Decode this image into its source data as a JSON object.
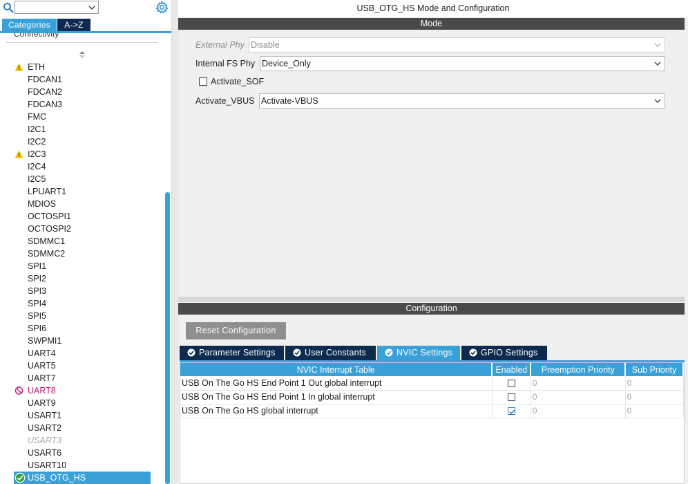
{
  "sidebar": {
    "search": {
      "value": ""
    },
    "tabs": [
      {
        "label": "Categories"
      },
      {
        "label": "A->Z"
      }
    ],
    "group_label": "Connectivity",
    "items": [
      {
        "label": "ETH",
        "status": "warning"
      },
      {
        "label": "FDCAN1",
        "status": "none"
      },
      {
        "label": "FDCAN2",
        "status": "none"
      },
      {
        "label": "FDCAN3",
        "status": "none"
      },
      {
        "label": "FMC",
        "status": "none"
      },
      {
        "label": "I2C1",
        "status": "none"
      },
      {
        "label": "I2C2",
        "status": "none"
      },
      {
        "label": "I2C3",
        "status": "warning"
      },
      {
        "label": "I2C4",
        "status": "none"
      },
      {
        "label": "I2C5",
        "status": "none"
      },
      {
        "label": "LPUART1",
        "status": "none"
      },
      {
        "label": "MDIOS",
        "status": "none"
      },
      {
        "label": "OCTOSPI1",
        "status": "none"
      },
      {
        "label": "OCTOSPI2",
        "status": "none"
      },
      {
        "label": "SDMMC1",
        "status": "none"
      },
      {
        "label": "SDMMC2",
        "status": "none"
      },
      {
        "label": "SPI1",
        "status": "none"
      },
      {
        "label": "SPI2",
        "status": "none"
      },
      {
        "label": "SPI3",
        "status": "none"
      },
      {
        "label": "SPI4",
        "status": "none"
      },
      {
        "label": "SPI5",
        "status": "none"
      },
      {
        "label": "SPI6",
        "status": "none"
      },
      {
        "label": "SWPMI1",
        "status": "none"
      },
      {
        "label": "UART4",
        "status": "none"
      },
      {
        "label": "UART5",
        "status": "none"
      },
      {
        "label": "UART7",
        "status": "none"
      },
      {
        "label": "UART8",
        "status": "error"
      },
      {
        "label": "UART9",
        "status": "none"
      },
      {
        "label": "USART1",
        "status": "none"
      },
      {
        "label": "USART2",
        "status": "none"
      },
      {
        "label": "USART3",
        "status": "disabled"
      },
      {
        "label": "USART6",
        "status": "none"
      },
      {
        "label": "USART10",
        "status": "none"
      },
      {
        "label": "USB_OTG_HS",
        "status": "selected"
      }
    ]
  },
  "main": {
    "title": "USB_OTG_HS Mode and Configuration",
    "mode": {
      "section_label": "Mode",
      "external_phy": {
        "label": "External Phy",
        "value": "Disable"
      },
      "internal_fs_phy": {
        "label": "Internal FS Phy",
        "value": "Device_Only"
      },
      "activate_sof": {
        "label": "Activate_SOF",
        "checked": false
      },
      "activate_vbus": {
        "label": "Activate_VBUS",
        "value": "Activate-VBUS"
      }
    },
    "configuration": {
      "section_label": "Configuration",
      "reset_button": "Reset Configuration",
      "tabs": [
        {
          "label": "Parameter Settings"
        },
        {
          "label": "User Constants"
        },
        {
          "label": "NVIC Settings"
        },
        {
          "label": "GPIO Settings"
        }
      ],
      "nvic": {
        "columns": [
          "NVIC Interrupt Table",
          "Enabled",
          "Preemption Priority",
          "Sub Priority"
        ],
        "rows": [
          {
            "name": "USB On The Go HS End Point 1 Out global interrupt",
            "enabled": false,
            "preemption": "0",
            "sub": "0"
          },
          {
            "name": "USB On The Go HS End Point 1 In global interrupt",
            "enabled": false,
            "preemption": "0",
            "sub": "0"
          },
          {
            "name": "USB On The Go HS global interrupt",
            "enabled": true,
            "preemption": "0",
            "sub": "0"
          }
        ]
      }
    }
  },
  "colors": {
    "accent": "#3aa0d8",
    "navy": "#0e2a4f",
    "section_bar": "#4a4a4a",
    "warning": "#f2c200",
    "error": "#c0157a",
    "ok": "#2f9e3c"
  }
}
